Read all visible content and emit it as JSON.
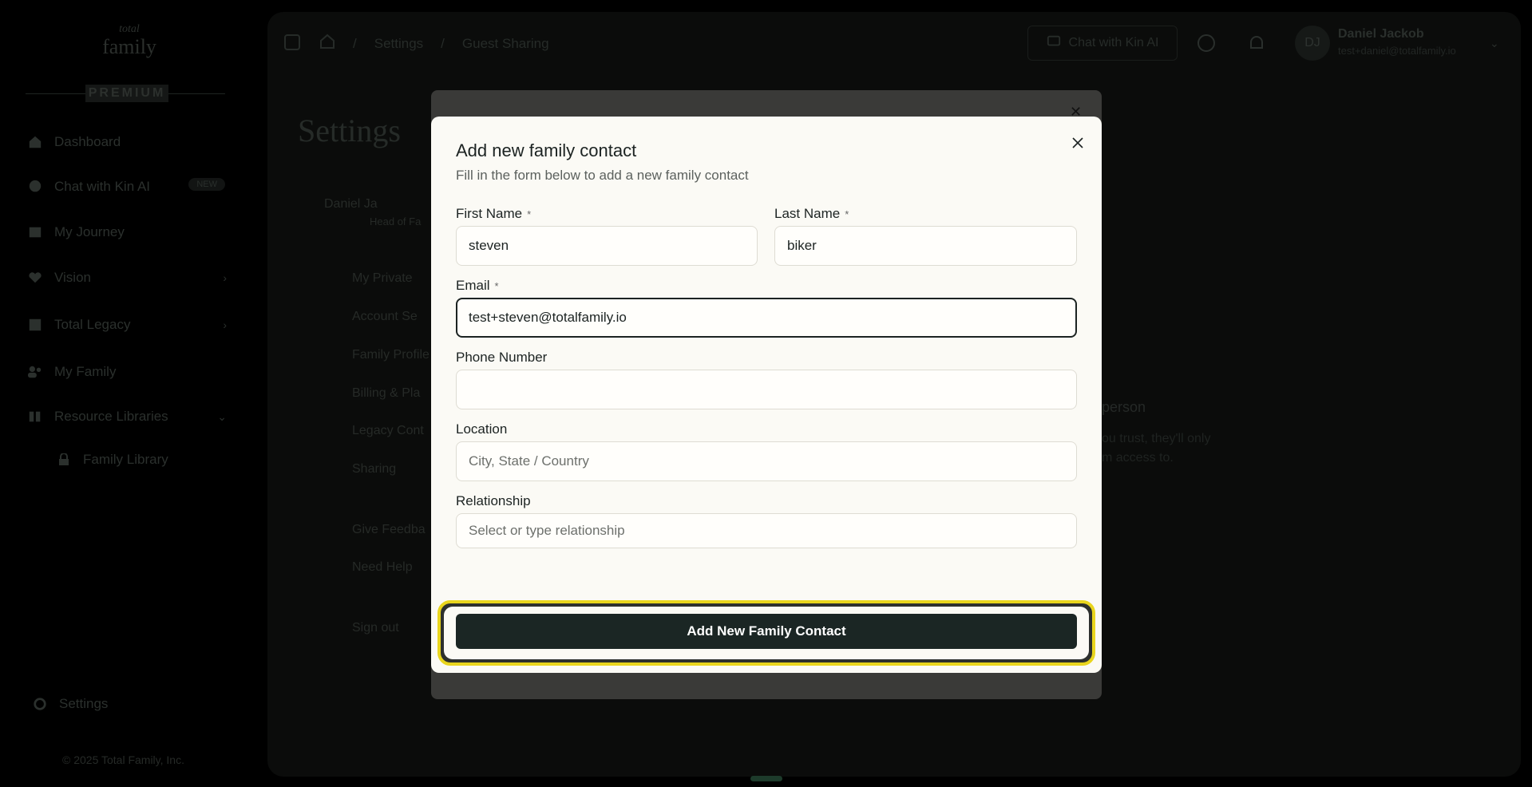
{
  "sidebar": {
    "logo_script": "total",
    "logo_text": "family",
    "premium_label": "PREMIUM",
    "items": [
      {
        "label": "Dashboard",
        "icon": "home-icon"
      },
      {
        "label": "Chat with Kin AI",
        "icon": "chat-bubble-icon",
        "badge": "NEW"
      },
      {
        "label": "My Journey",
        "icon": "map-icon"
      },
      {
        "label": "Vision",
        "icon": "heart-icon"
      },
      {
        "label": "Total Legacy",
        "icon": "legacy-icon"
      },
      {
        "label": "My Family",
        "icon": "users-icon"
      },
      {
        "label": "Resource Libraries",
        "icon": "library-icon"
      },
      {
        "label": "Family Library",
        "icon": "lock-icon"
      }
    ],
    "settings_label": "Settings",
    "footer": "© 2025 Total Family, Inc."
  },
  "topbar": {
    "breadcrumb_settings": "Settings",
    "breadcrumb_current": "Guest Sharing",
    "chat_button": "Chat with Kin AI",
    "user_initials": "DJ",
    "user_name": "Daniel Jackob",
    "user_email": "test+daniel@totalfamily.io"
  },
  "page": {
    "heading": "Settings",
    "profile_name": "Daniel Ja",
    "profile_sub": "Head of Fa",
    "menu": [
      "My Private",
      "Account Se",
      "Family Profile",
      "Billing & Pla",
      "Legacy Cont",
      "Sharing",
      "Give Feedba",
      "Need Help",
      "Sign out"
    ],
    "side_title": "person",
    "side_line1": "ou trust, they'll only",
    "side_line2": "m access to."
  },
  "modal": {
    "title": "Add new family contact",
    "subtitle": "Fill in the form below to add a new family contact",
    "required_mark": "*",
    "first_name_label": "First Name",
    "first_name_value": "steven",
    "last_name_label": "Last Name",
    "last_name_value": "biker",
    "email_label": "Email",
    "email_value": "test+steven@totalfamily.io",
    "phone_label": "Phone Number",
    "phone_value": "",
    "location_label": "Location",
    "location_placeholder": "City, State / Country",
    "relationship_label": "Relationship",
    "relationship_placeholder": "Select or type relationship",
    "submit_label": "Add New Family Contact"
  },
  "colors": {
    "modal_bg": "#fbfaf5",
    "primary_button": "#1b2624",
    "focus_ring": "#e9d51d",
    "backdrop": "#000000"
  }
}
